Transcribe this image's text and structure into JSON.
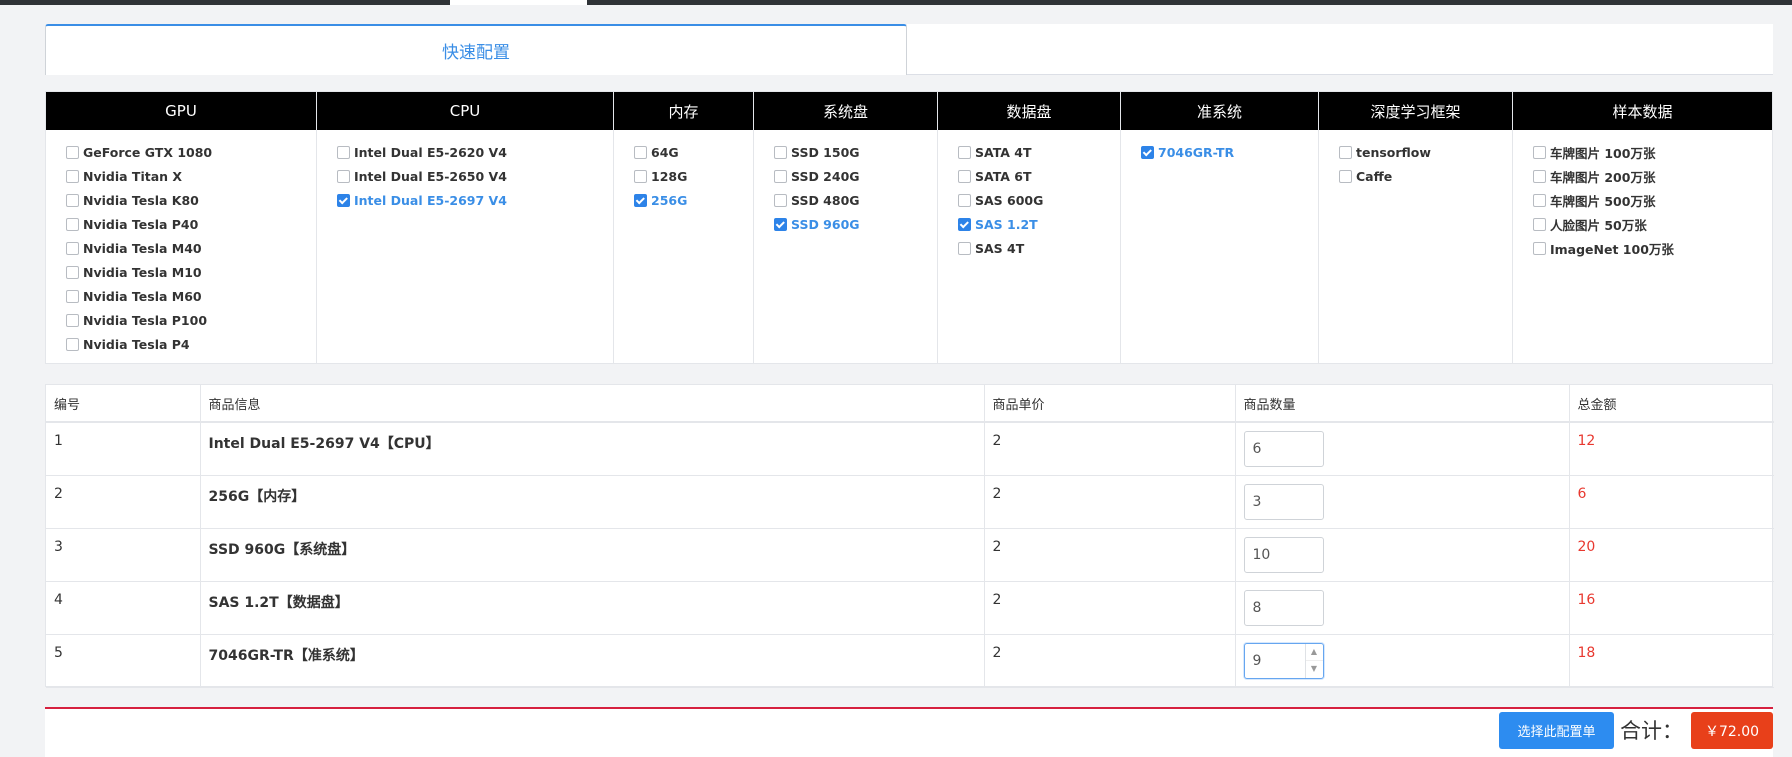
{
  "tabs": {
    "active": "快速配置"
  },
  "config_columns": [
    {
      "header": "GPU",
      "options": [
        {
          "label": "GeForce GTX 1080",
          "checked": false
        },
        {
          "label": "Nvidia Titan X",
          "checked": false
        },
        {
          "label": "Nvidia Tesla K80",
          "checked": false
        },
        {
          "label": "Nvidia Tesla P40",
          "checked": false
        },
        {
          "label": "Nvidia Tesla M40",
          "checked": false
        },
        {
          "label": "Nvidia Tesla M10",
          "checked": false
        },
        {
          "label": "Nvidia Tesla M60",
          "checked": false
        },
        {
          "label": "Nvidia Tesla P100",
          "checked": false
        },
        {
          "label": "Nvidia Tesla P4",
          "checked": false
        }
      ]
    },
    {
      "header": "CPU",
      "options": [
        {
          "label": "Intel Dual E5-2620 V4",
          "checked": false
        },
        {
          "label": "Intel Dual E5-2650 V4",
          "checked": false
        },
        {
          "label": "Intel Dual E5-2697 V4",
          "checked": true
        }
      ]
    },
    {
      "header": "内存",
      "options": [
        {
          "label": "64G",
          "checked": false
        },
        {
          "label": "128G",
          "checked": false
        },
        {
          "label": "256G",
          "checked": true
        }
      ]
    },
    {
      "header": "系统盘",
      "options": [
        {
          "label": "SSD 150G",
          "checked": false
        },
        {
          "label": "SSD 240G",
          "checked": false
        },
        {
          "label": "SSD 480G",
          "checked": false
        },
        {
          "label": "SSD 960G",
          "checked": true
        }
      ]
    },
    {
      "header": "数据盘",
      "options": [
        {
          "label": "SATA 4T",
          "checked": false
        },
        {
          "label": "SATA 6T",
          "checked": false
        },
        {
          "label": "SAS 600G",
          "checked": false
        },
        {
          "label": "SAS 1.2T",
          "checked": true
        },
        {
          "label": "SAS 4T",
          "checked": false
        }
      ]
    },
    {
      "header": "准系统",
      "options": [
        {
          "label": "7046GR-TR",
          "checked": true
        }
      ]
    },
    {
      "header": "深度学习框架",
      "options": [
        {
          "label": "tensorflow",
          "checked": false
        },
        {
          "label": "Caffe",
          "checked": false
        }
      ]
    },
    {
      "header": "样本数据",
      "options": [
        {
          "label": "车牌图片 100万张",
          "checked": false
        },
        {
          "label": "车牌图片 200万张",
          "checked": false
        },
        {
          "label": "车牌图片 500万张",
          "checked": false
        },
        {
          "label": "人脸图片 50万张",
          "checked": false
        },
        {
          "label": "ImageNet 100万张",
          "checked": false
        }
      ]
    }
  ],
  "cart": {
    "headers": [
      "编号",
      "商品信息",
      "商品单价",
      "商品数量",
      "总金额"
    ],
    "rows": [
      {
        "no": "1",
        "info": "Intel Dual E5-2697 V4【CPU】",
        "price": "2",
        "qty": "6",
        "total": "12"
      },
      {
        "no": "2",
        "info": "256G【内存】",
        "price": "2",
        "qty": "3",
        "total": "6"
      },
      {
        "no": "3",
        "info": "SSD 960G【系统盘】",
        "price": "2",
        "qty": "10",
        "total": "20"
      },
      {
        "no": "4",
        "info": "SAS 1.2T【数据盘】",
        "price": "2",
        "qty": "8",
        "total": "16"
      },
      {
        "no": "5",
        "info": "7046GR-TR【准系统】",
        "price": "2",
        "qty": "9",
        "total": "18"
      }
    ]
  },
  "footer": {
    "choose_label": "选择此配置单",
    "sum_label": "合计：",
    "sum_value": "￥72.00"
  },
  "colors": {
    "accent": "#3a8ee6",
    "header_bg": "#000000",
    "total_red": "#e8382f",
    "sum_bg": "#e8401a",
    "divider": "#d6203f"
  }
}
